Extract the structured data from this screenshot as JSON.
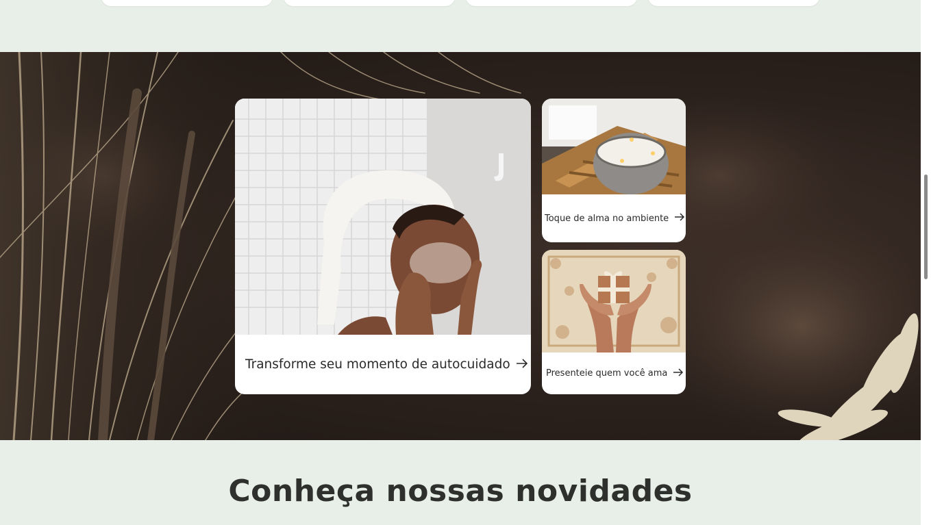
{
  "banner": {
    "cards": [
      {
        "label": "Transforme seu momento de autocuidado",
        "arrow": "→"
      },
      {
        "label": "Toque de alma no ambiente",
        "arrow": "→"
      },
      {
        "label": "Presenteie quem você ama",
        "arrow": "→"
      }
    ]
  },
  "section": {
    "title": "Conheça nossas novidades"
  },
  "colors": {
    "page_bg": "#e8efe8",
    "banner_bg": "#2b211c",
    "card_bg": "#ffffff",
    "text": "#2a2a2a"
  }
}
